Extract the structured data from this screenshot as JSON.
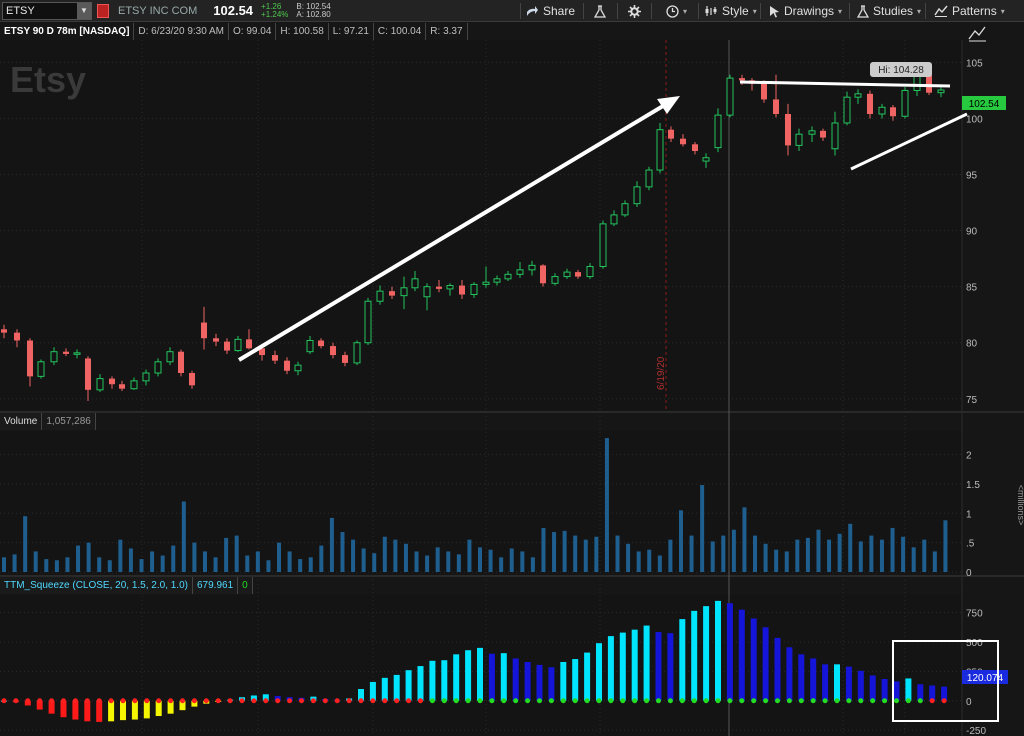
{
  "toolbar": {
    "symbol": "ETSY",
    "company": "ETSY INC COM",
    "last": "102.54",
    "change": "+1.26",
    "change_pct": "+1.24%",
    "bid": "B: 102.54",
    "ask": "A: 102.80",
    "share": "Share",
    "style": "Style",
    "drawings": "Drawings",
    "studies": "Studies",
    "patterns": "Patterns"
  },
  "infobar": {
    "title": "ETSY 90 D 78m [NASDAQ]",
    "date": "D: 6/23/20 9:30 AM",
    "open": "O: 99.04",
    "high": "H: 100.58",
    "low": "L: 97.21",
    "close": "C: 100.04",
    "range": "R: 3.37"
  },
  "price_pane": {
    "watermark": "Etsy",
    "hi_label": "Hi: 104.28",
    "price_tag": "102.54",
    "date_marker": "6/19/20",
    "yticks": [
      "105",
      "100",
      "95",
      "90",
      "85",
      "80",
      "75"
    ]
  },
  "volume_pane": {
    "label": "Volume",
    "value": "1,057,286",
    "yticks": [
      "2",
      "1.5",
      "1",
      ".5",
      "0"
    ],
    "unit": "<millions>"
  },
  "squeeze_pane": {
    "label": "TTM_Squeeze (CLOSE, 20, 1.5, 2.0, 1.0)",
    "value": "679.961",
    "value2": "0",
    "tag": "120.074",
    "yticks": [
      "750",
      "500",
      "250",
      "0",
      "-250"
    ]
  },
  "colors": {
    "up": "#22c55e",
    "down": "#f06464",
    "volume": "#1f5f8f",
    "cyan": "#00e5ff",
    "blue": "#1515d9",
    "red": "#ff1a1a",
    "yellow": "#f5f500",
    "dot_green": "#22dd22",
    "dot_red": "#ff2020"
  },
  "chart_data": {
    "type": "candlestick",
    "ylim": [
      74,
      107
    ],
    "candles": [
      [
        81.2,
        81.6,
        80.4,
        80.9
      ],
      [
        80.9,
        81.2,
        79.6,
        80.2
      ],
      [
        80.2,
        80.4,
        76.1,
        77.0
      ],
      [
        77.0,
        78.5,
        76.8,
        78.3
      ],
      [
        78.3,
        79.6,
        78.0,
        79.2
      ],
      [
        79.2,
        79.5,
        78.8,
        79.0
      ],
      [
        79.0,
        79.4,
        78.6,
        79.1
      ],
      [
        78.6,
        78.8,
        74.8,
        75.8
      ],
      [
        75.8,
        77.2,
        75.6,
        76.8
      ],
      [
        76.8,
        77.0,
        75.9,
        76.3
      ],
      [
        76.3,
        76.6,
        75.7,
        75.9
      ],
      [
        75.9,
        76.9,
        75.8,
        76.6
      ],
      [
        76.6,
        77.6,
        76.2,
        77.3
      ],
      [
        77.3,
        78.6,
        77.0,
        78.3
      ],
      [
        78.3,
        79.6,
        78.0,
        79.2
      ],
      [
        79.2,
        79.4,
        77.0,
        77.3
      ],
      [
        77.3,
        77.5,
        75.9,
        76.2
      ],
      [
        81.8,
        83.2,
        79.4,
        80.4
      ],
      [
        80.4,
        80.8,
        79.7,
        80.1
      ],
      [
        80.1,
        80.4,
        79.0,
        79.3
      ],
      [
        79.3,
        80.6,
        79.2,
        80.3
      ],
      [
        80.3,
        81.2,
        79.4,
        79.5
      ],
      [
        79.5,
        79.9,
        78.4,
        78.9
      ],
      [
        78.9,
        79.3,
        78.1,
        78.4
      ],
      [
        78.4,
        78.7,
        77.2,
        77.5
      ],
      [
        77.5,
        78.3,
        77.1,
        78.0
      ],
      [
        79.2,
        80.6,
        79.0,
        80.2
      ],
      [
        80.2,
        80.4,
        79.5,
        79.7
      ],
      [
        79.7,
        80.0,
        78.6,
        78.9
      ],
      [
        78.9,
        79.2,
        77.9,
        78.2
      ],
      [
        78.2,
        80.2,
        78.0,
        80.0
      ],
      [
        80.0,
        84.0,
        79.8,
        83.7
      ],
      [
        83.7,
        85.1,
        83.4,
        84.6
      ],
      [
        84.6,
        85.0,
        83.9,
        84.2
      ],
      [
        84.2,
        85.9,
        83.0,
        84.9
      ],
      [
        84.9,
        86.4,
        84.6,
        85.7
      ],
      [
        84.1,
        85.3,
        82.9,
        85.0
      ],
      [
        85.0,
        85.6,
        84.5,
        84.8
      ],
      [
        84.8,
        85.3,
        84.2,
        85.1
      ],
      [
        85.1,
        85.6,
        83.9,
        84.3
      ],
      [
        84.3,
        85.4,
        84.0,
        85.2
      ],
      [
        85.2,
        86.8,
        84.9,
        85.4
      ],
      [
        85.4,
        86.0,
        85.1,
        85.7
      ],
      [
        85.7,
        86.4,
        85.5,
        86.1
      ],
      [
        86.1,
        87.2,
        85.8,
        86.5
      ],
      [
        86.5,
        87.3,
        86.0,
        86.9
      ],
      [
        86.9,
        87.0,
        85.0,
        85.3
      ],
      [
        85.3,
        86.2,
        85.1,
        85.9
      ],
      [
        85.9,
        86.6,
        85.7,
        86.3
      ],
      [
        86.3,
        86.5,
        85.7,
        85.9
      ],
      [
        85.9,
        87.1,
        85.7,
        86.8
      ],
      [
        86.8,
        90.9,
        86.6,
        90.6
      ],
      [
        90.6,
        91.8,
        90.4,
        91.4
      ],
      [
        91.4,
        92.7,
        91.2,
        92.4
      ],
      [
        92.4,
        94.4,
        92.1,
        93.9
      ],
      [
        93.9,
        95.7,
        93.6,
        95.4
      ],
      [
        95.4,
        99.6,
        95.1,
        99.0
      ],
      [
        99.0,
        99.3,
        97.9,
        98.2
      ],
      [
        98.2,
        98.6,
        97.5,
        97.7
      ],
      [
        97.7,
        97.9,
        96.8,
        97.1
      ],
      [
        96.2,
        96.9,
        95.6,
        96.5
      ],
      [
        97.4,
        100.9,
        97.0,
        100.3
      ],
      [
        100.3,
        103.9,
        100.1,
        103.6
      ],
      [
        103.6,
        103.9,
        103.0,
        103.4
      ],
      [
        103.4,
        103.6,
        102.5,
        103.1
      ],
      [
        103.1,
        103.4,
        101.4,
        101.7
      ],
      [
        101.7,
        103.9,
        100.1,
        100.4
      ],
      [
        100.4,
        101.3,
        96.7,
        97.6
      ],
      [
        97.6,
        99.1,
        97.1,
        98.6
      ],
      [
        98.6,
        99.3,
        97.9,
        98.9
      ],
      [
        98.9,
        99.1,
        98.0,
        98.3
      ],
      [
        97.3,
        100.6,
        96.7,
        99.6
      ],
      [
        99.6,
        102.4,
        99.4,
        101.9
      ],
      [
        101.9,
        102.6,
        101.3,
        102.2
      ],
      [
        102.2,
        102.5,
        100.0,
        100.4
      ],
      [
        100.4,
        101.3,
        100.0,
        101.0
      ],
      [
        101.0,
        101.2,
        99.8,
        100.2
      ],
      [
        100.2,
        102.8,
        100.0,
        102.5
      ],
      [
        102.5,
        104.3,
        102.0,
        104.0
      ],
      [
        104.0,
        104.28,
        102.1,
        102.3
      ],
      [
        102.3,
        102.8,
        101.9,
        102.54
      ]
    ],
    "candle_x": [
      4,
      17,
      30,
      41,
      54,
      66,
      77,
      88,
      100,
      112,
      122,
      134,
      146,
      158,
      170,
      181,
      192,
      204,
      216,
      227,
      238,
      249,
      262,
      275,
      287,
      298,
      310,
      321,
      333,
      345,
      357,
      368,
      380,
      392,
      404,
      415,
      427,
      439,
      450,
      462,
      474,
      486,
      497,
      508,
      520,
      532,
      543,
      555,
      567,
      578,
      590,
      603,
      614,
      625,
      637,
      649,
      660,
      671,
      683,
      695,
      706,
      718,
      730,
      742,
      752,
      764,
      776,
      788,
      799,
      812,
      823,
      835,
      847,
      858,
      870,
      882,
      893,
      905,
      917,
      929,
      941,
      952
    ],
    "volume": [
      0.25,
      0.3,
      0.95,
      0.35,
      0.22,
      0.2,
      0.25,
      0.45,
      0.5,
      0.25,
      0.2,
      0.55,
      0.4,
      0.22,
      0.35,
      0.28,
      0.45,
      1.2,
      0.5,
      0.35,
      0.25,
      0.58,
      0.62,
      0.28,
      0.35,
      0.2,
      0.5,
      0.35,
      0.22,
      0.25,
      0.45,
      0.92,
      0.68,
      0.55,
      0.4,
      0.32,
      0.6,
      0.55,
      0.48,
      0.35,
      0.28,
      0.42,
      0.35,
      0.3,
      0.55,
      0.42,
      0.38,
      0.25,
      0.4,
      0.35,
      0.25,
      0.75,
      0.68,
      0.7,
      0.62,
      0.55,
      0.6,
      2.28,
      0.62,
      0.48,
      0.35,
      0.38,
      0.28,
      0.55,
      1.05,
      0.62,
      1.48,
      0.52,
      0.62,
      0.72,
      1.1,
      0.62,
      0.48,
      0.38,
      0.35,
      0.55,
      0.58,
      0.72,
      0.55,
      0.65,
      0.82,
      0.52,
      0.62,
      0.55,
      0.75,
      0.6,
      0.42,
      0.55,
      0.35,
      0.88
    ],
    "volume_ylim": [
      0,
      2.4
    ],
    "squeeze": [
      0,
      -12,
      -40,
      -75,
      -110,
      -140,
      -160,
      -175,
      -180,
      -175,
      -165,
      -160,
      -150,
      -130,
      -110,
      -80,
      -50,
      -25,
      -10,
      10,
      30,
      45,
      55,
      40,
      30,
      25,
      35,
      15,
      10,
      20,
      100,
      160,
      195,
      220,
      260,
      295,
      340,
      345,
      395,
      430,
      450,
      400,
      405,
      360,
      330,
      305,
      285,
      330,
      355,
      410,
      490,
      550,
      580,
      605,
      640,
      585,
      575,
      695,
      765,
      805,
      850,
      830,
      775,
      700,
      625,
      535,
      455,
      395,
      360,
      310,
      310,
      290,
      255,
      215,
      185,
      165,
      190,
      140,
      130,
      120
    ],
    "squeeze_ylim": [
      -300,
      900
    ]
  }
}
